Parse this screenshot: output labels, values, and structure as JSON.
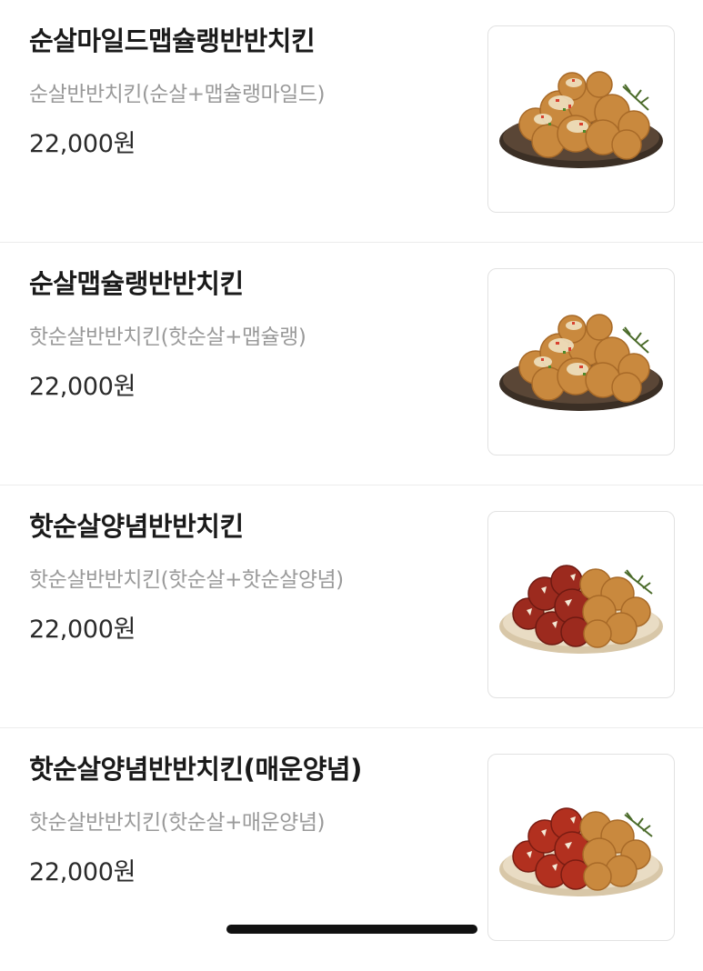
{
  "menu": {
    "items": [
      {
        "name": "순살마일드맵슐랭반반치킨",
        "description": "순살반반치킨(순살+맵슐랭마일드)",
        "price": "22,000원",
        "image": "boneless-mapchelin-mild-chicken-photo"
      },
      {
        "name": "순살맵슐랭반반치킨",
        "description": "핫순살반반치킨(핫순살+맵슐랭)",
        "price": "22,000원",
        "image": "boneless-mapchelin-chicken-photo"
      },
      {
        "name": "핫순살양념반반치킨",
        "description": "핫순살반반치킨(핫순살+핫순살양념)",
        "price": "22,000원",
        "image": "hot-boneless-seasoned-chicken-photo"
      },
      {
        "name": "핫순살양념반반치킨(매운양념)",
        "description": "핫순살반반치킨(핫순살+매운양념)",
        "price": "22,000원",
        "image": "hot-boneless-spicy-seasoned-chicken-photo"
      }
    ]
  },
  "colors": {
    "name_text": "#1a1a1a",
    "description_text": "#9a9a9a",
    "price_text": "#2a2a2a",
    "divider": "#ececec",
    "fried_chicken": "#c9893e",
    "sauce_chicken": "#9c2a1e"
  }
}
